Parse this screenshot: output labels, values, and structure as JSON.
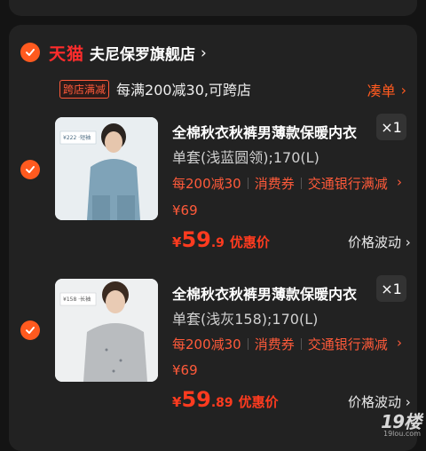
{
  "store": {
    "brand": "天猫",
    "name": "夫尼保罗旗舰店",
    "chevron": "›"
  },
  "promo": {
    "tag": "跨店满减",
    "text": "每满200减30,可跨店",
    "action": "凑单",
    "action_chevron": "›"
  },
  "items": [
    {
      "title": "全棉秋衣秋裤男薄款保暖内衣",
      "qty": "×1",
      "spec": "单套(浅蓝圆领);170(L)",
      "tags": [
        "每200减30",
        "消费券",
        "交通银行满减"
      ],
      "tags_chevron": "›",
      "orig_price": "¥69",
      "price_currency": "¥",
      "price_int": "59",
      "price_dec": ".9",
      "price_label": "优惠价",
      "fluct": "价格波动",
      "fluct_chevron": "›",
      "thumb_badge": "¥222 ·短袖",
      "thumb_color": "#7fa3b8"
    },
    {
      "title": "全棉秋衣秋裤男薄款保暖内衣",
      "qty": "×1",
      "spec": "单套(浅灰158);170(L)",
      "tags": [
        "每200减30",
        "消费券",
        "交通银行满减"
      ],
      "tags_chevron": "›",
      "orig_price": "¥69",
      "price_currency": "¥",
      "price_int": "59",
      "price_dec": ".89",
      "price_label": "优惠价",
      "fluct": "价格波动",
      "fluct_chevron": "›",
      "thumb_badge": "¥158 ·长袖",
      "thumb_color": "#b9bcbf"
    }
  ],
  "watermark": {
    "big": "19楼",
    "small": "19lou.com"
  },
  "colors": {
    "accent": "#ff5a1f",
    "brand_red": "#ff2c2c",
    "price_red": "#ff3b1f",
    "card_bg": "#222222",
    "page_bg": "#141414"
  }
}
